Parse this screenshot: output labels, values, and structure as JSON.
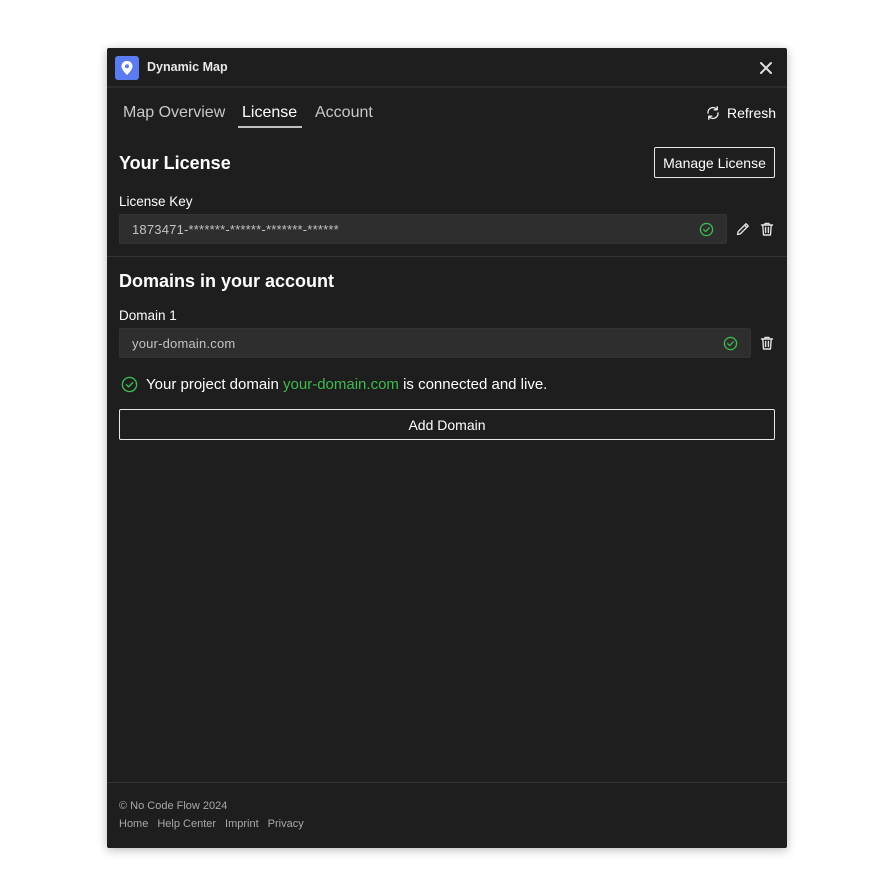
{
  "window": {
    "title": "Dynamic Map"
  },
  "tabs": [
    {
      "label": "Map Overview",
      "active": false
    },
    {
      "label": "License",
      "active": true
    },
    {
      "label": "Account",
      "active": false
    }
  ],
  "toolbar": {
    "refresh_label": "Refresh"
  },
  "license": {
    "title": "Your License",
    "manage_label": "Manage License",
    "key_label": "License Key",
    "key_value": "1873471-*******-******-*******-******"
  },
  "domains": {
    "title": "Domains in your account",
    "items": [
      {
        "label": "Domain 1",
        "value": "your-domain.com"
      }
    ],
    "status": {
      "prefix": "Your project domain ",
      "domain": "your-domain.com",
      "suffix": " is connected and live."
    },
    "add_label": "Add Domain"
  },
  "footer": {
    "copyright": "© No Code Flow 2024",
    "links": [
      "Home",
      "Help Center",
      "Imprint",
      "Privacy"
    ]
  },
  "colors": {
    "accent_green": "#3fb950",
    "app_icon": "#5b7cf0",
    "window_bg": "#1e1e1e"
  },
  "icons": [
    "map-pin-icon",
    "close-icon",
    "refresh-icon",
    "check-circle-icon",
    "pencil-icon",
    "trash-icon"
  ]
}
